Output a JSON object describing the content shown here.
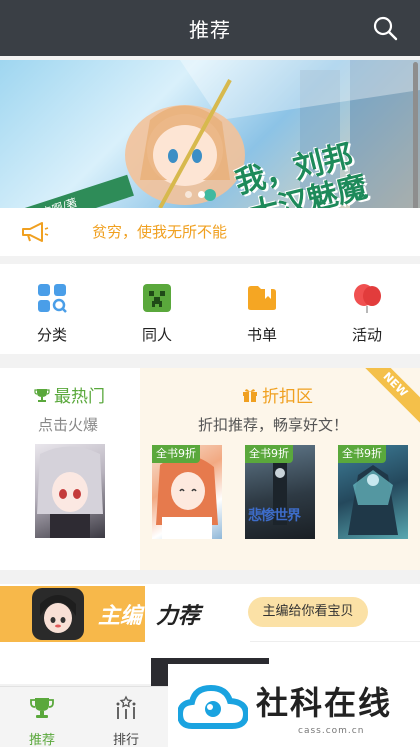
{
  "header": {
    "title": "推荐",
    "search_icon": "search-icon"
  },
  "banner": {
    "title_line1": "我，刘邦",
    "title_line2": "大汉魅魔",
    "ribbon": "超想吃肉啊/著",
    "slides": 2,
    "active_slide": 1
  },
  "notice": {
    "icon": "megaphone-icon",
    "text": "贫穷，使我无所不能",
    "color": "#f0a020"
  },
  "nav": {
    "items": [
      {
        "label": "分类",
        "icon": "grid-search-icon"
      },
      {
        "label": "同人",
        "icon": "creeper-icon"
      },
      {
        "label": "书单",
        "icon": "booklist-icon"
      },
      {
        "label": "活动",
        "icon": "balloon-icon"
      }
    ]
  },
  "promo": {
    "hot": {
      "title": "最热门",
      "subtitle": "点击火爆",
      "icon": "trophy-icon"
    },
    "discount": {
      "title": "折扣区",
      "subtitle": "折扣推荐，畅享好文！",
      "icon": "gift-icon",
      "badge": "NEW",
      "books": [
        {
          "tag": "全书9折"
        },
        {
          "tag": "全书9折",
          "cover_text": "悲惨世界"
        },
        {
          "tag": "全书9折"
        }
      ]
    }
  },
  "editor": {
    "title_part1": "主编",
    "title_part2": "力荐",
    "pill": "主编给你看宝贝"
  },
  "tabbar": {
    "tabs": [
      {
        "label": "推荐",
        "icon": "trophy-icon",
        "active": true
      },
      {
        "label": "排行",
        "icon": "ranking-icon",
        "active": false
      }
    ]
  },
  "watermark": {
    "text": "社科在线",
    "url": "cass.com.cn"
  },
  "colors": {
    "accent_green": "#5aa83c",
    "accent_orange": "#f0a020",
    "header_bg": "#3a3f45"
  }
}
